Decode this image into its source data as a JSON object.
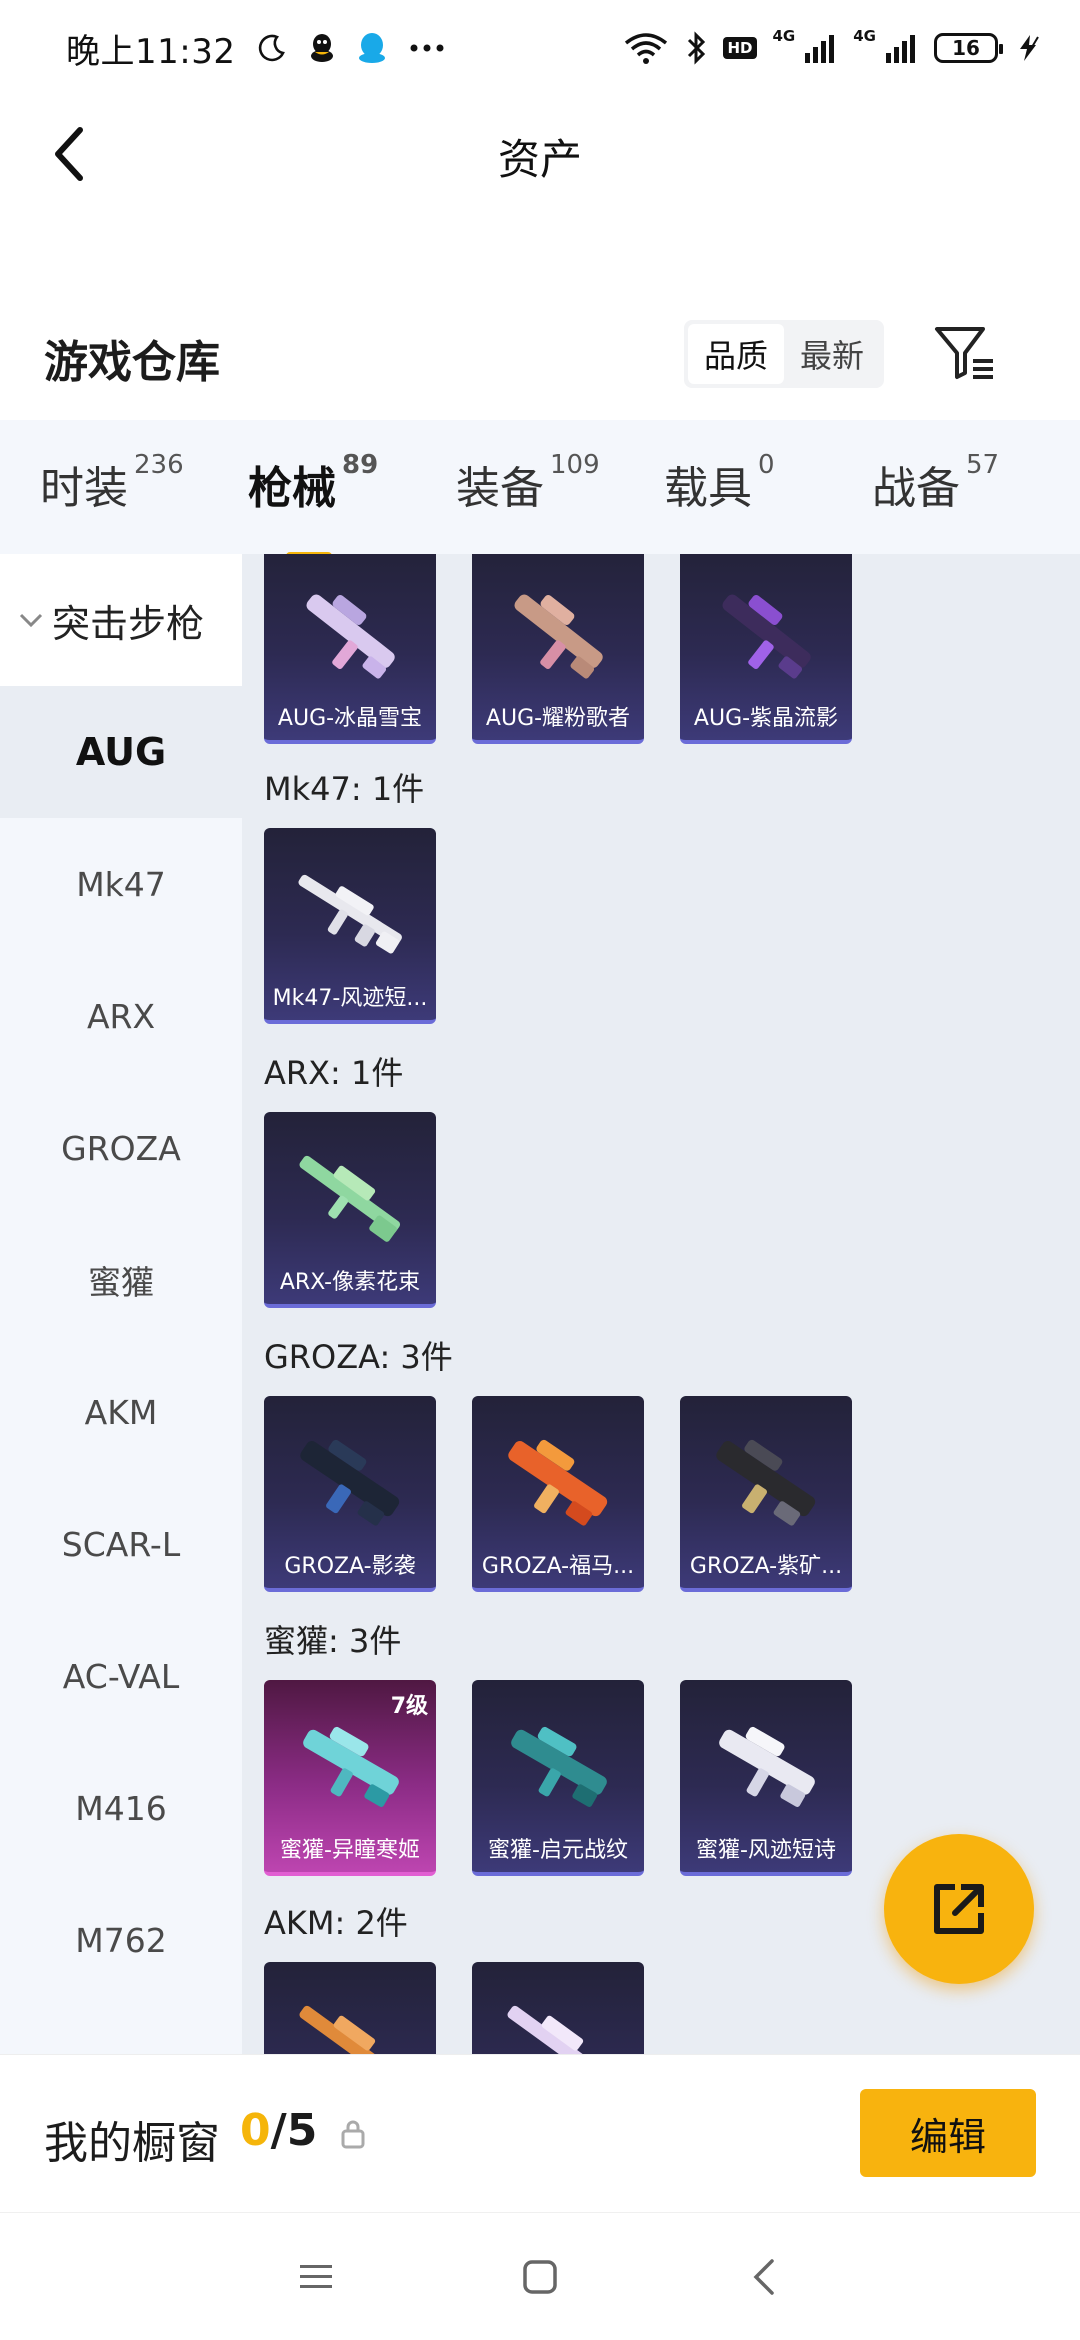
{
  "status_bar": {
    "time": "晚上11:32",
    "sig1_label": "4G",
    "sig2_label": "4G",
    "hd_label": "HD",
    "battery": "16"
  },
  "header": {
    "title": "资产"
  },
  "warehouse": {
    "title": "游戏仓库",
    "sort_options": [
      "品质",
      "最新"
    ],
    "sort_active": "品质"
  },
  "tabs": [
    {
      "label": "时装",
      "count": "236"
    },
    {
      "label": "枪械",
      "count": "89",
      "active": true
    },
    {
      "label": "装备",
      "count": "109"
    },
    {
      "label": "载具",
      "count": "0"
    },
    {
      "label": "战备",
      "count": "57"
    }
  ],
  "sidebar": {
    "group": "突击步枪",
    "items": [
      "AUG",
      "Mk47",
      "ARX",
      "GROZA",
      "蜜獾",
      "AKM",
      "SCAR-L",
      "AC-VAL",
      "M416",
      "M762"
    ],
    "active": "AUG"
  },
  "content": {
    "aug_cards": [
      "AUG-冰晶雪宝",
      "AUG-耀粉歌者",
      "AUG-紫晶流影"
    ],
    "mk47_label": "Mk47: 1件",
    "mk47_cards": [
      "Mk47-风迹短..."
    ],
    "arx_label": "ARX: 1件",
    "arx_cards": [
      "ARX-像素花束"
    ],
    "groza_label": "GROZA: 3件",
    "groza_cards": [
      "GROZA-影袭",
      "GROZA-福马...",
      "GROZA-紫矿..."
    ],
    "honey_label": "蜜獾: 3件",
    "honey_cards": [
      "蜜獾-异瞳寒姬",
      "蜜獾-启元战纹",
      "蜜獾-风迹短诗"
    ],
    "honey_level": "7级",
    "akm_label": "AKM: 2件"
  },
  "showcase": {
    "title": "我的橱窗",
    "count_current": "0",
    "count_sep": "/5",
    "edit_label": "编辑"
  },
  "colors": {
    "accent": "#f8b30e",
    "tab_bg": "#f4f7fc",
    "content_bg": "#e9edf3",
    "card_dark": "#2d2a52",
    "card_pink": "#bd45b0"
  }
}
